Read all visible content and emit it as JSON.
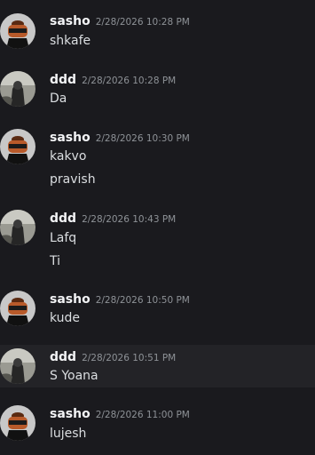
{
  "messages": [
    {
      "username": "sasho",
      "avatar": "sasho-avatar",
      "timestamp": "2/28/2026 10:28 PM",
      "lines": [
        "shkafe"
      ]
    },
    {
      "username": "ddd",
      "avatar": "ddd-avatar",
      "timestamp": "2/28/2026 10:28 PM",
      "lines": [
        "Da"
      ]
    },
    {
      "username": "sasho",
      "avatar": "sasho-avatar",
      "timestamp": "2/28/2026 10:30 PM",
      "lines": [
        "kakvo",
        "pravish"
      ]
    },
    {
      "username": "ddd",
      "avatar": "ddd-avatar",
      "timestamp": "2/28/2026 10:43 PM",
      "lines": [
        "Lafq",
        "Ti"
      ]
    },
    {
      "username": "sasho",
      "avatar": "sasho-avatar",
      "timestamp": "2/28/2026 10:50 PM",
      "lines": [
        "kude"
      ]
    },
    {
      "username": "ddd",
      "avatar": "ddd-avatar",
      "timestamp": "2/28/2026 10:51 PM",
      "lines": [
        "S Yoana"
      ]
    },
    {
      "username": "sasho",
      "avatar": "sasho-avatar",
      "timestamp": "2/28/2026 11:00 PM",
      "lines": [
        "lujesh"
      ]
    }
  ],
  "colors": {
    "background": "#1a1a1e",
    "hover_background": "#232327",
    "username": "#f2f3f5",
    "timestamp": "#8e9297",
    "text": "#dbdee1"
  }
}
